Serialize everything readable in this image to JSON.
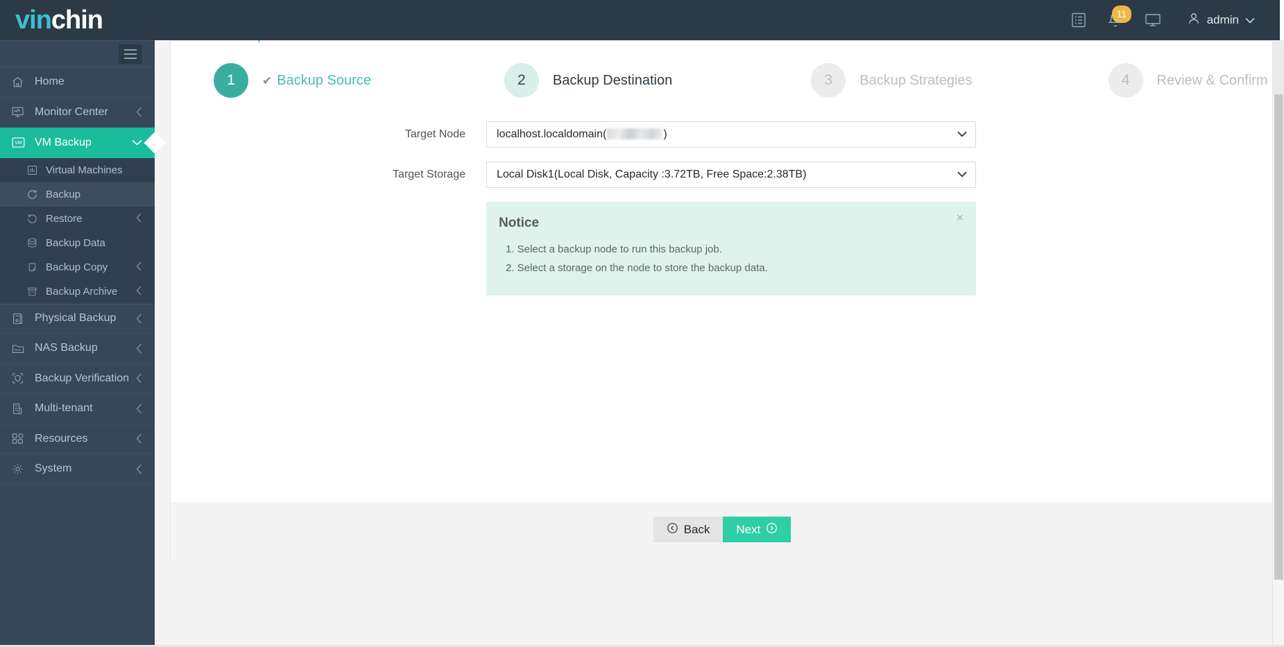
{
  "header": {
    "logo_part1": "vin",
    "logo_part2": "chin",
    "notification_count": "11",
    "user_name": "admin",
    "icons": {
      "list": "list-icon",
      "bell": "bell-icon",
      "monitor": "monitor-icon",
      "user": "user-icon",
      "chevron": "chevron-down-icon"
    }
  },
  "sidebar": {
    "items": [
      {
        "label": "Home",
        "icon": "home-icon",
        "has_chevron": false,
        "active": false,
        "level": 0
      },
      {
        "label": "Monitor Center",
        "icon": "monitor-chart-icon",
        "has_chevron": true,
        "active": false,
        "level": 0
      },
      {
        "label": "VM Backup",
        "icon": "vm-icon",
        "has_chevron": true,
        "active": true,
        "level": 0
      },
      {
        "label": "Virtual Machines",
        "icon": "virtual-machines-icon",
        "has_chevron": false,
        "active": false,
        "level": 1
      },
      {
        "label": "Backup",
        "icon": "backup-refresh-icon",
        "has_chevron": false,
        "active": false,
        "selected": true,
        "level": 1
      },
      {
        "label": "Restore",
        "icon": "restore-icon",
        "has_chevron": true,
        "active": false,
        "level": 1
      },
      {
        "label": "Backup Data",
        "icon": "database-icon",
        "has_chevron": false,
        "active": false,
        "level": 1
      },
      {
        "label": "Backup Copy",
        "icon": "copy-icon",
        "has_chevron": true,
        "active": false,
        "level": 1
      },
      {
        "label": "Backup Archive",
        "icon": "archive-icon",
        "has_chevron": true,
        "active": false,
        "level": 1
      },
      {
        "label": "Physical Backup",
        "icon": "server-icon",
        "has_chevron": true,
        "active": false,
        "level": 0
      },
      {
        "label": "NAS Backup",
        "icon": "nas-folder-icon",
        "has_chevron": true,
        "active": false,
        "level": 0
      },
      {
        "label": "Backup Verification",
        "icon": "shield-check-icon",
        "has_chevron": true,
        "active": false,
        "level": 0
      },
      {
        "label": "Multi-tenant",
        "icon": "building-icon",
        "has_chevron": true,
        "active": false,
        "level": 0
      },
      {
        "label": "Resources",
        "icon": "grid-icon",
        "has_chevron": true,
        "active": false,
        "level": 0
      },
      {
        "label": "System",
        "icon": "gear-icon",
        "has_chevron": true,
        "active": false,
        "level": 0
      }
    ]
  },
  "page": {
    "title": "New Backup Job"
  },
  "wizard": {
    "steps": [
      {
        "number": "1",
        "label": "Backup Source",
        "state": "done",
        "check": "✔"
      },
      {
        "number": "2",
        "label": "Backup Destination",
        "state": "current"
      },
      {
        "number": "3",
        "label": "Backup Strategies",
        "state": "todo"
      },
      {
        "number": "4",
        "label": "Review & Confirm",
        "state": "todo"
      }
    ]
  },
  "form": {
    "target_node": {
      "label": "Target Node",
      "value_prefix": "localhost.localdomain(",
      "value_suffix": ")",
      "redacted": true
    },
    "target_storage": {
      "label": "Target Storage",
      "value": "Local Disk1(Local Disk, Capacity :3.72TB, Free Space:2.38TB)"
    }
  },
  "notice": {
    "title": "Notice",
    "close_label": "×",
    "items": [
      "1. Select a backup node to run this backup job.",
      "2. Select a storage on the node to store the backup data."
    ]
  },
  "footer": {
    "back_label": "Back",
    "next_label": "Next"
  },
  "colors": {
    "brand_teal": "#1abc9c",
    "header_dark": "#2c3a47",
    "sidebar": "#37475a",
    "notice_bg": "#def3ec",
    "badge": "#f0b849",
    "next_button": "#2ecfa4"
  }
}
